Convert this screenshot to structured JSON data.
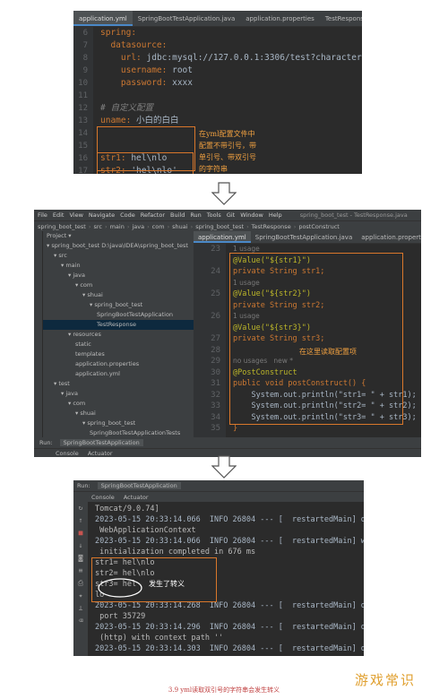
{
  "section1": {
    "tabs": [
      "application.yml",
      "SpringBootTestApplication.java",
      "application.properties",
      "TestResponse.java"
    ],
    "line_numbers": [
      "6",
      "7",
      "8",
      "9",
      "10",
      "11",
      "12",
      "13",
      "14",
      "15",
      "16",
      "17",
      "18"
    ],
    "lines": [
      {
        "indent": "",
        "key": "spring:",
        "val": ""
      },
      {
        "indent": "  ",
        "key": "datasource:",
        "val": ""
      },
      {
        "indent": "    ",
        "key": "url: ",
        "val": "jdbc:mysql://127.0.0.1:3306/test?characterEncoding=utf8"
      },
      {
        "indent": "    ",
        "key": "username: ",
        "val": "root"
      },
      {
        "indent": "    ",
        "key": "password: ",
        "val": "xxxx"
      },
      {
        "indent": "",
        "key": "",
        "val": ""
      },
      {
        "indent": "",
        "key": "",
        "val": "# 自定义配置",
        "cmt": true
      },
      {
        "indent": "",
        "key": "uname: ",
        "val": "小白的白白"
      },
      {
        "indent": "",
        "key": "",
        "val": ""
      },
      {
        "indent": "",
        "key": "",
        "val": ""
      },
      {
        "indent": "",
        "key": "str1: ",
        "val": "hel\\nlo"
      },
      {
        "indent": "",
        "key": "str2: ",
        "val": "'hel\\nlo'"
      },
      {
        "indent": "",
        "key": "str3: ",
        "val": "\"hel\\nlo\""
      }
    ],
    "note": "在yml配置文件中\n配置不带引号，带\n单引号、带双引号\n的字符串"
  },
  "section2": {
    "menu": [
      "File",
      "Edit",
      "View",
      "Navigate",
      "Code",
      "Refactor",
      "Build",
      "Run",
      "Tools",
      "Git",
      "Window",
      "Help",
      "spring_boot_test - TestResponse.java"
    ],
    "crumbs": [
      "spring_boot_test",
      "src",
      "main",
      "java",
      "com",
      "shuai",
      "spring_boot_test",
      "TestResponse",
      "postConstruct"
    ],
    "tabs": [
      "application.yml",
      "SpringBootTestApplication.java",
      "application.properties"
    ],
    "tree": [
      {
        "d": 0,
        "t": "Project ▾"
      },
      {
        "d": 0,
        "t": "▾ spring_boot_test  D:\\java\\IDEA\\spring_boot_test"
      },
      {
        "d": 1,
        "t": "▾ src"
      },
      {
        "d": 2,
        "t": "▾ main"
      },
      {
        "d": 3,
        "t": "▾ java"
      },
      {
        "d": 4,
        "t": "▾ com"
      },
      {
        "d": 5,
        "t": "▾ shuai"
      },
      {
        "d": 6,
        "t": "▾ spring_boot_test"
      },
      {
        "d": 7,
        "t": "SpringBootTestApplication"
      },
      {
        "d": 7,
        "t": "TestResponse",
        "sel": true
      },
      {
        "d": 3,
        "t": "▾ resources"
      },
      {
        "d": 4,
        "t": "static"
      },
      {
        "d": 4,
        "t": "templates"
      },
      {
        "d": 4,
        "t": "application.properties"
      },
      {
        "d": 4,
        "t": "application.yml"
      },
      {
        "d": 1,
        "t": "▾ test"
      },
      {
        "d": 2,
        "t": "▾ java"
      },
      {
        "d": 3,
        "t": "▾ com"
      },
      {
        "d": 4,
        "t": "▾ shuai"
      },
      {
        "d": 5,
        "t": "▾ spring_boot_test"
      },
      {
        "d": 6,
        "t": "SpringBootTestApplicationTests"
      },
      {
        "d": 1,
        "t": "▸ target"
      },
      {
        "d": 1,
        "t": ".gitignore"
      },
      {
        "d": 1,
        "t": "pom.xml"
      },
      {
        "d": 0,
        "t": "▸ External Libraries"
      }
    ],
    "line_numbers": [
      "23",
      "",
      "24",
      "",
      "25",
      "",
      "26",
      "",
      "27",
      "28",
      "29",
      "30",
      "31",
      "32",
      "33",
      "34",
      "35"
    ],
    "lines": [
      {
        "t": "1 usage",
        "h": true
      },
      {
        "a": "@Value(\"${str1}\")"
      },
      {
        "p": "private String str1;"
      },
      {
        "t": "1 usage",
        "h": true
      },
      {
        "a": "@Value(\"${str2}\")"
      },
      {
        "p": "private String str2;"
      },
      {
        "t": "1 usage",
        "h": true
      },
      {
        "a": "@Value(\"${str3}\")"
      },
      {
        "p": "private String str3;"
      },
      {
        "t": "",
        "h": true
      },
      {
        "t": "no usages   new *",
        "h": true
      },
      {
        "a": "@PostConstruct"
      },
      {
        "p": "public void postConstruct() {"
      },
      {
        "s": "    System.out.println(\"str1= \" + str1);"
      },
      {
        "s": "    System.out.println(\"str2= \" + str2);"
      },
      {
        "s": "    System.out.println(\"str3= \" + str3);"
      },
      {
        "p": "}"
      }
    ],
    "note": "在这里读取配置项",
    "run_label": "Run:",
    "run_tab": "SpringBootTestApplication",
    "console_tab": "Console",
    "actuator_tab": "Actuator"
  },
  "section3": {
    "run_label": "Run:",
    "run_tab": "SpringBootTestApplication",
    "console_tab": "Console",
    "actuator_tab": "Actuator",
    "lines": [
      "Tomcat/9.0.74]",
      "2023-05-15 20:33:14.066  INFO 26804 --- [  restartedMain] o.a.c.c",
      " WebApplicationContext",
      "2023-05-15 20:33:14.066  INFO 26804 --- [  restartedMain] w.s.c.S",
      " initialization completed in 676 ms",
      "str1= hel\\nlo",
      "str2= hel\\nlo",
      "str3= hel",
      "lo",
      "2023-05-15 20:33:14.268  INFO 26804 --- [  restartedMain] o.s.b.d",
      " port 35729",
      "2023-05-15 20:33:14.296  INFO 26804 --- [  restartedMain] o.s.b.w",
      " (http) with context path ''",
      "2023-05-15 20:33:14.303  INFO 26804 --- [  restartedMain] o.s.b.S"
    ],
    "note": "发生了转义"
  },
  "caption": "3.9 yml读取双引号的字符串会发生转义",
  "watermark": "游戏常识"
}
